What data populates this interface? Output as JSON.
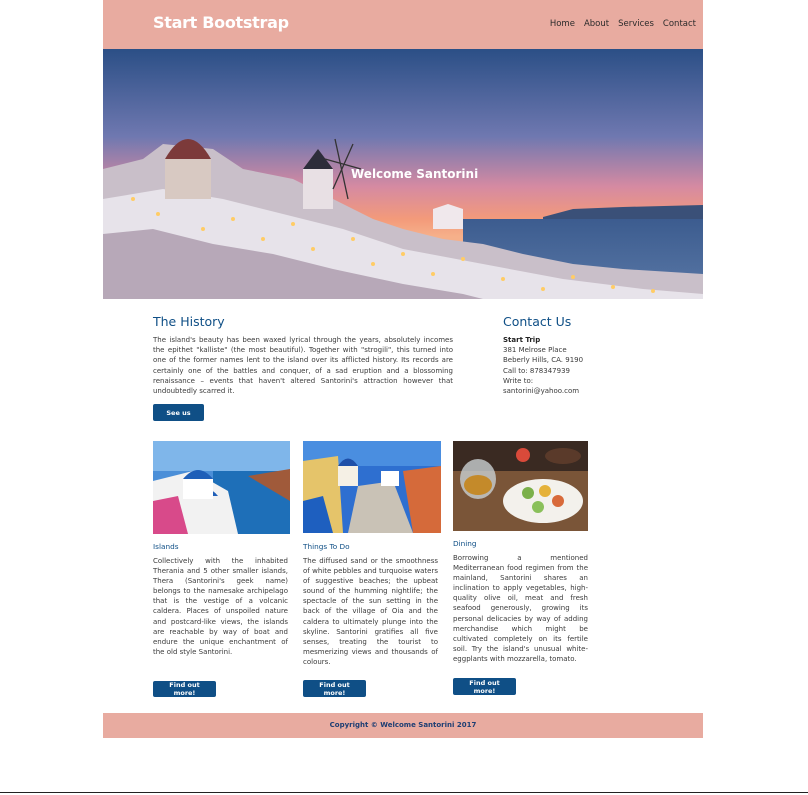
{
  "navbar": {
    "brand": "Start Bootstrap",
    "links": [
      "Home",
      "About",
      "Services",
      "Contact"
    ]
  },
  "hero": {
    "title": "Welcome Santorini"
  },
  "history": {
    "heading": "The History",
    "text": "The island's beauty has been waxed lyrical through the years, absolutely incomes the epithet \"kalliste\" (the most beautiful). Together with \"strogili\", this turned into one of the former names lent to the island over its afflicted history. Its records are certainly one of the battles and conquer, of a sad eruption and a blossoming renaissance – events that haven't altered Santorini's attraction however that undoubtedly scarred it.",
    "button": "See us"
  },
  "contact": {
    "heading": "Contact Us",
    "name": "Start Trip",
    "lines": [
      "381 Melrose Place",
      "Beberly Hills, CA. 9190",
      "Call to: 878347939",
      "Write to:",
      "santorini@yahoo.com"
    ]
  },
  "cards": [
    {
      "title": "Islands",
      "text": "Collectively with the inhabited Therania and 5 other smaller islands, Thera (Santorini's geek name) belongs to the namesake archipelago that is the vestige of a volcanic caldera. Places of unspoiled nature and postcard-like views, the islands are reachable by way of boat and endure the unique enchantment of the old style Santorini.",
      "button": "Find out more!"
    },
    {
      "title": "Things To Do",
      "text": "The diffused sand or the smoothness of white pebbles and turquoise waters of suggestive beaches; the upbeat sound of the humming nightlife; the spectacle of the sun setting in the back of the village of Oia and the caldera to ultimately plunge into the skyline. Santorini gratifies all five senses, treating the tourist to mesmerizing views and thousands of colours.",
      "button": "Find out more!"
    },
    {
      "title": "Dining",
      "text": "Borrowing a mentioned Mediterranean food regimen from the mainland, Santorini shares an inclination to apply vegetables, high-quality olive oil, meat and fresh seafood generously, growing its personal delicacies by way of adding merchandise which might be cultivated completely on its fertile soil. Try the island's unusual white-eggplants with mozzarella, tomato.",
      "button": "Find out more!"
    }
  ],
  "footer": {
    "text": "Copyright © Welcome Santorini 2017"
  },
  "colors": {
    "accent": "#e8aba0",
    "primary": "#0f4f86"
  }
}
